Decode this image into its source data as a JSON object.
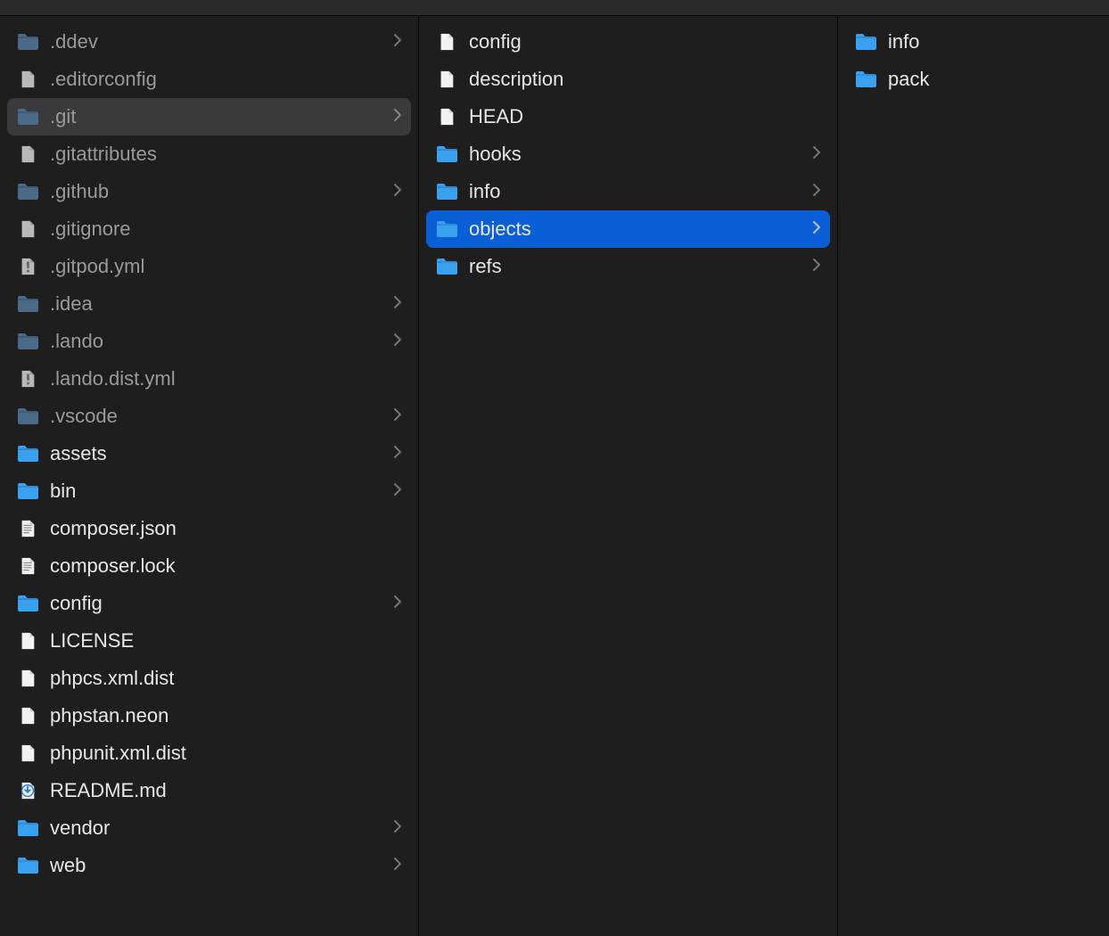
{
  "colors": {
    "folder_blue": "#3aa0f0",
    "folder_dim": "#4a6a88",
    "file_white": "#f2f2f2",
    "file_dim": "#b8b8b8",
    "file_exclaim": "#8a8a8a",
    "selection_grey": "#3a3a3c",
    "selection_blue": "#0a5fd6"
  },
  "columns": [
    {
      "items": [
        {
          "name": ".ddev",
          "type": "folder",
          "dimmed": true,
          "expandable": true
        },
        {
          "name": ".editorconfig",
          "type": "file",
          "dimmed": true
        },
        {
          "name": ".git",
          "type": "folder",
          "dimmed": true,
          "expandable": true,
          "selected": "grey"
        },
        {
          "name": ".gitattributes",
          "type": "file",
          "dimmed": true
        },
        {
          "name": ".github",
          "type": "folder",
          "dimmed": true,
          "expandable": true
        },
        {
          "name": ".gitignore",
          "type": "file",
          "dimmed": true
        },
        {
          "name": ".gitpod.yml",
          "type": "file-exclaim",
          "dimmed": true
        },
        {
          "name": ".idea",
          "type": "folder",
          "dimmed": true,
          "expandable": true
        },
        {
          "name": ".lando",
          "type": "folder",
          "dimmed": true,
          "expandable": true
        },
        {
          "name": ".lando.dist.yml",
          "type": "file-exclaim",
          "dimmed": true
        },
        {
          "name": ".vscode",
          "type": "folder",
          "dimmed": true,
          "expandable": true
        },
        {
          "name": "assets",
          "type": "folder",
          "expandable": true
        },
        {
          "name": "bin",
          "type": "folder",
          "expandable": true
        },
        {
          "name": "composer.json",
          "type": "file-lines"
        },
        {
          "name": "composer.lock",
          "type": "file-lines"
        },
        {
          "name": "config",
          "type": "folder",
          "expandable": true
        },
        {
          "name": "LICENSE",
          "type": "file"
        },
        {
          "name": "phpcs.xml.dist",
          "type": "file"
        },
        {
          "name": "phpstan.neon",
          "type": "file"
        },
        {
          "name": "phpunit.xml.dist",
          "type": "file"
        },
        {
          "name": "README.md",
          "type": "file-download"
        },
        {
          "name": "vendor",
          "type": "folder",
          "expandable": true
        },
        {
          "name": "web",
          "type": "folder",
          "expandable": true
        }
      ]
    },
    {
      "items": [
        {
          "name": "config",
          "type": "file"
        },
        {
          "name": "description",
          "type": "file"
        },
        {
          "name": "HEAD",
          "type": "file"
        },
        {
          "name": "hooks",
          "type": "folder",
          "expandable": true
        },
        {
          "name": "info",
          "type": "folder",
          "expandable": true
        },
        {
          "name": "objects",
          "type": "folder",
          "expandable": true,
          "selected": "blue"
        },
        {
          "name": "refs",
          "type": "folder",
          "expandable": true
        }
      ]
    },
    {
      "items": [
        {
          "name": "info",
          "type": "folder"
        },
        {
          "name": "pack",
          "type": "folder"
        }
      ]
    }
  ]
}
